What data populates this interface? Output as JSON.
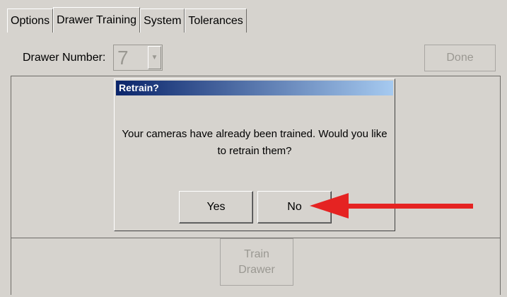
{
  "tabs": [
    {
      "label": "Options"
    },
    {
      "label": "Drawer Training",
      "active": true
    },
    {
      "label": "System"
    },
    {
      "label": "Tolerances"
    }
  ],
  "drawer": {
    "label": "Drawer Number:",
    "value": "7",
    "arrow_icon": "dropdown-arrow-icon"
  },
  "done_button": "Done",
  "train_button": {
    "line1": "Train",
    "line2": "Drawer"
  },
  "dialog": {
    "title": "Retrain?",
    "message": "Your cameras have already been trained.  Would you like to retrain them?",
    "yes": "Yes",
    "no": "No"
  },
  "annotation": {
    "color": "#e52322",
    "icon": "red-arrow-icon"
  }
}
